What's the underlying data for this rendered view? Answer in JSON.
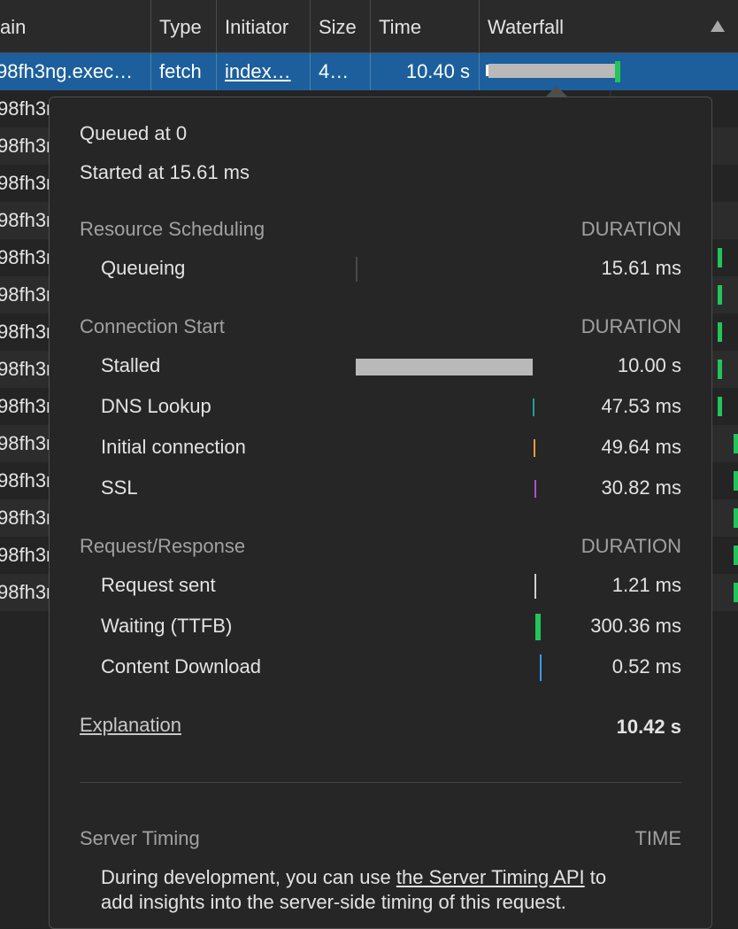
{
  "header": {
    "columns": [
      "ain",
      "Type",
      "Initiator",
      "Size",
      "Time",
      "Waterfall"
    ]
  },
  "selected_row": {
    "name": "98fh3ng.exec…",
    "type": "fetch",
    "initiator": "index…",
    "size": "4…",
    "time": "10.40 s"
  },
  "rows": [
    "98fh3n",
    "98fh3n",
    "98fh3n",
    "98fh3n",
    "98fh3n",
    "98fh3n",
    "98fh3n",
    "98fh3n",
    "98fh3n",
    "98fh3n",
    "98fh3n",
    "98fh3n",
    "98fh3n",
    "98fh3n"
  ],
  "timing": {
    "queued": "Queued at 0",
    "started": "Started at 15.61 ms",
    "duration_label": "DURATION",
    "resource_scheduling": {
      "title": "Resource Scheduling",
      "items": [
        {
          "label": "Queueing",
          "value": "15.61 ms"
        }
      ]
    },
    "connection_start": {
      "title": "Connection Start",
      "items": [
        {
          "label": "Stalled",
          "value": "10.00 s"
        },
        {
          "label": "DNS Lookup",
          "value": "47.53 ms"
        },
        {
          "label": "Initial connection",
          "value": "49.64 ms"
        },
        {
          "label": "SSL",
          "value": "30.82 ms"
        }
      ]
    },
    "request_response": {
      "title": "Request/Response",
      "items": [
        {
          "label": "Request sent",
          "value": "1.21 ms"
        },
        {
          "label": "Waiting (TTFB)",
          "value": "300.36 ms"
        },
        {
          "label": "Content Download",
          "value": "0.52 ms"
        }
      ]
    },
    "explanation": "Explanation",
    "total": "10.42 s",
    "server_timing": {
      "title": "Server Timing",
      "time_label": "TIME",
      "desc_before": "During development, you can use ",
      "link": "the Server Timing API",
      "desc_after": " to",
      "desc_line2": "add insights into the server-side timing of this request."
    }
  },
  "colors": {
    "selected_row": "#1c5f9c",
    "stalled": "#b9b9b9",
    "dns": "#1f9e9e",
    "initial_connection": "#f29b32",
    "ssl": "#b44cd1",
    "request_sent": "#d0d0d0",
    "ttfb": "#23c45a",
    "content_download": "#3a9be8"
  }
}
